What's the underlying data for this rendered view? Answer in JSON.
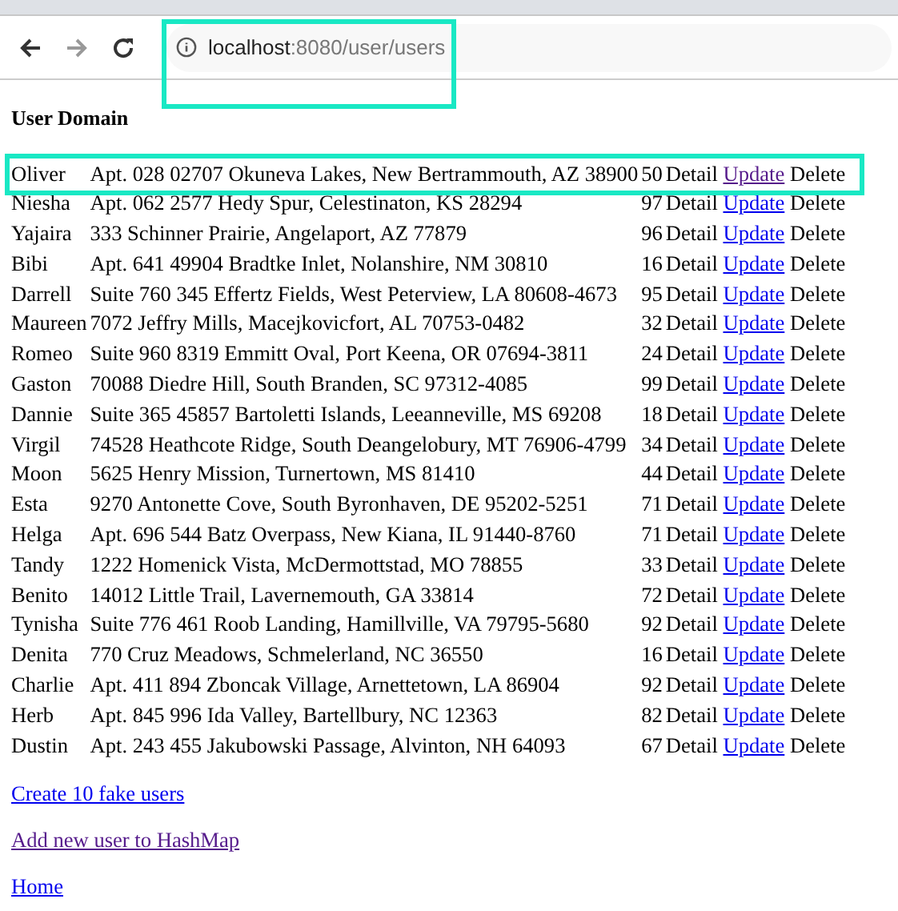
{
  "browser": {
    "address": {
      "host": "localhost",
      "path": ":8080/user/users",
      "highlighted": true
    }
  },
  "heading": "User Domain",
  "users": [
    {
      "name": "Oliver",
      "address": "Apt. 028 02707 Okuneva Lakes, New Bertrammouth, AZ 38900",
      "age": "50",
      "detail": "Detail",
      "update": "Update",
      "delete": "Delete",
      "visited": true,
      "highlighted": true
    },
    {
      "name": "Niesha",
      "address": "Apt. 062 2577 Hedy Spur, Celestinaton, KS 28294",
      "age": "97",
      "detail": "Detail",
      "update": "Update",
      "delete": "Delete",
      "visited": false,
      "highlighted": false
    },
    {
      "name": "Yajaira",
      "address": "333 Schinner Prairie, Angelaport, AZ 77879",
      "age": "96",
      "detail": "Detail",
      "update": "Update",
      "delete": "Delete",
      "visited": false,
      "highlighted": false
    },
    {
      "name": "Bibi",
      "address": "Apt. 641 49904 Bradtke Inlet, Nolanshire, NM 30810",
      "age": "16",
      "detail": "Detail",
      "update": "Update",
      "delete": "Delete",
      "visited": false,
      "highlighted": false
    },
    {
      "name": "Darrell",
      "address": "Suite 760 345 Effertz Fields, West Peterview, LA 80608-4673",
      "age": "95",
      "detail": "Detail",
      "update": "Update",
      "delete": "Delete",
      "visited": false,
      "highlighted": false
    },
    {
      "name": "Maureen",
      "address": "7072 Jeffry Mills, Macejkovicfort, AL 70753-0482",
      "age": "32",
      "detail": "Detail",
      "update": "Update",
      "delete": "Delete",
      "visited": false,
      "highlighted": false
    },
    {
      "name": "Romeo",
      "address": "Suite 960 8319 Emmitt Oval, Port Keena, OR 07694-3811",
      "age": "24",
      "detail": "Detail",
      "update": "Update",
      "delete": "Delete",
      "visited": false,
      "highlighted": false
    },
    {
      "name": "Gaston",
      "address": "70088 Diedre Hill, South Branden, SC 97312-4085",
      "age": "99",
      "detail": "Detail",
      "update": "Update",
      "delete": "Delete",
      "visited": false,
      "highlighted": false
    },
    {
      "name": "Dannie",
      "address": "Suite 365 45857 Bartoletti Islands, Leeanneville, MS 69208",
      "age": "18",
      "detail": "Detail",
      "update": "Update",
      "delete": "Delete",
      "visited": false,
      "highlighted": false
    },
    {
      "name": "Virgil",
      "address": "74528 Heathcote Ridge, South Deangelobury, MT 76906-4799",
      "age": "34",
      "detail": "Detail",
      "update": "Update",
      "delete": "Delete",
      "visited": false,
      "highlighted": false
    },
    {
      "name": "Moon",
      "address": "5625 Henry Mission, Turnertown, MS 81410",
      "age": "44",
      "detail": "Detail",
      "update": "Update",
      "delete": "Delete",
      "visited": false,
      "highlighted": false
    },
    {
      "name": "Esta",
      "address": "9270 Antonette Cove, South Byronhaven, DE 95202-5251",
      "age": "71",
      "detail": "Detail",
      "update": "Update",
      "delete": "Delete",
      "visited": false,
      "highlighted": false
    },
    {
      "name": "Helga",
      "address": "Apt. 696 544 Batz Overpass, New Kiana, IL 91440-8760",
      "age": "71",
      "detail": "Detail",
      "update": "Update",
      "delete": "Delete",
      "visited": false,
      "highlighted": false
    },
    {
      "name": "Tandy",
      "address": "1222 Homenick Vista, McDermottstad, MO 78855",
      "age": "33",
      "detail": "Detail",
      "update": "Update",
      "delete": "Delete",
      "visited": false,
      "highlighted": false
    },
    {
      "name": "Benito",
      "address": "14012 Little Trail, Lavernemouth, GA 33814",
      "age": "72",
      "detail": "Detail",
      "update": "Update",
      "delete": "Delete",
      "visited": false,
      "highlighted": false
    },
    {
      "name": "Tynisha",
      "address": "Suite 776 461 Roob Landing, Hamillville, VA 79795-5680",
      "age": "92",
      "detail": "Detail",
      "update": "Update",
      "delete": "Delete",
      "visited": false,
      "highlighted": false
    },
    {
      "name": "Denita",
      "address": "770 Cruz Meadows, Schmelerland, NC 36550",
      "age": "16",
      "detail": "Detail",
      "update": "Update",
      "delete": "Delete",
      "visited": false,
      "highlighted": false
    },
    {
      "name": "Charlie",
      "address": "Apt. 411 894 Zboncak Village, Arnettetown, LA 86904",
      "age": "92",
      "detail": "Detail",
      "update": "Update",
      "delete": "Delete",
      "visited": false,
      "highlighted": false
    },
    {
      "name": "Herb",
      "address": "Apt. 845 996 Ida Valley, Bartellbury, NC 12363",
      "age": "82",
      "detail": "Detail",
      "update": "Update",
      "delete": "Delete",
      "visited": false,
      "highlighted": false
    },
    {
      "name": "Dustin",
      "address": "Apt. 243 455 Jakubowski Passage, Alvinton, NH 64093",
      "age": "67",
      "detail": "Detail",
      "update": "Update",
      "delete": "Delete",
      "visited": false,
      "highlighted": false
    }
  ],
  "links": [
    {
      "label": "Create 10 fake users",
      "visited": false
    },
    {
      "label": "Add new user to HashMap",
      "visited": true
    },
    {
      "label": "Home",
      "visited": false
    }
  ]
}
